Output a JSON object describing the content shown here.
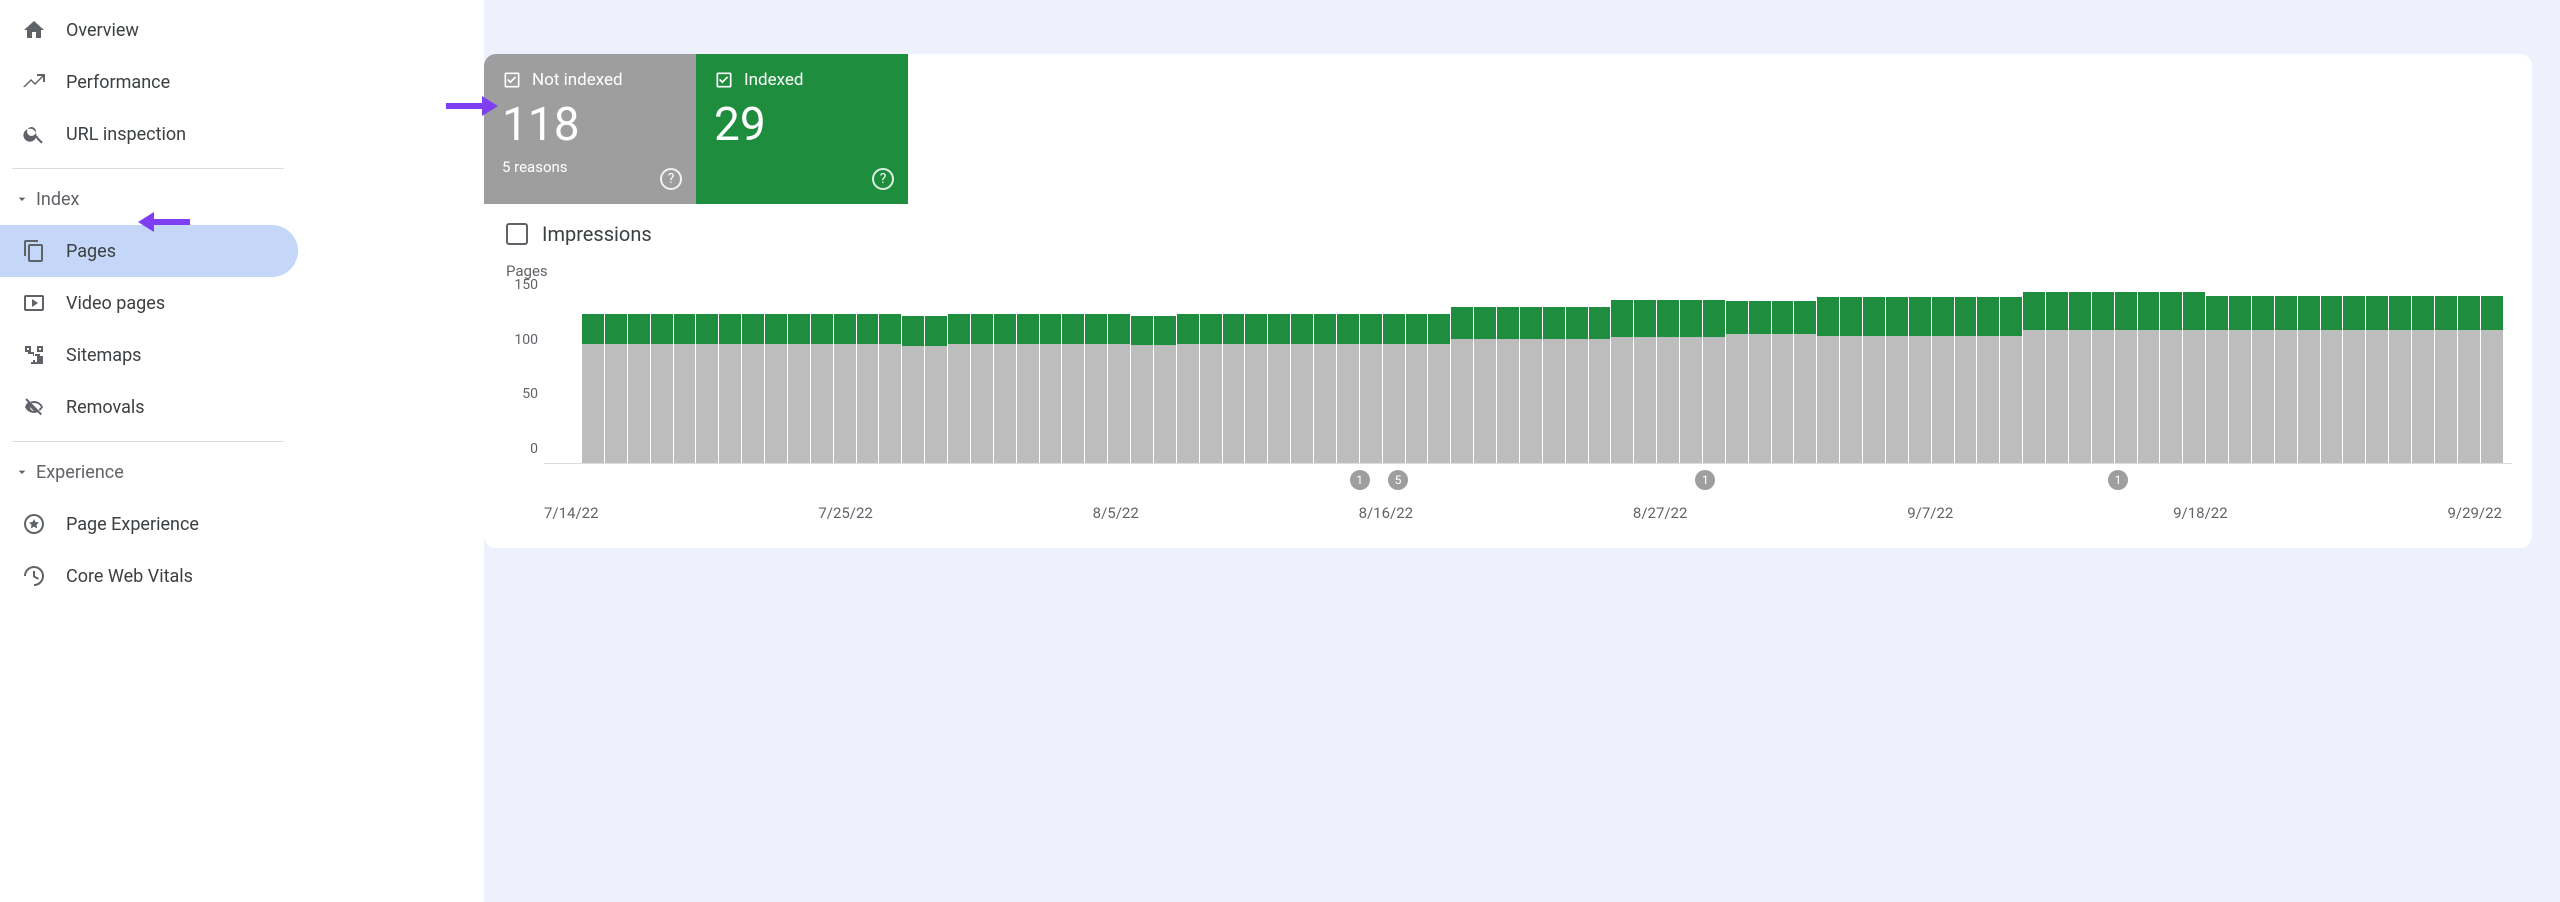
{
  "sidebar": {
    "top": [
      {
        "label": "Overview",
        "icon": "home"
      },
      {
        "label": "Performance",
        "icon": "trend"
      },
      {
        "label": "URL inspection",
        "icon": "search"
      }
    ],
    "sections": [
      {
        "title": "Index",
        "items": [
          {
            "label": "Pages",
            "icon": "pages",
            "active": true
          },
          {
            "label": "Video pages",
            "icon": "video"
          },
          {
            "label": "Sitemaps",
            "icon": "sitemap"
          },
          {
            "label": "Removals",
            "icon": "eye-off"
          }
        ]
      },
      {
        "title": "Experience",
        "items": [
          {
            "label": "Page Experience",
            "icon": "star-circle"
          },
          {
            "label": "Core Web Vitals",
            "icon": "speed"
          }
        ]
      }
    ]
  },
  "stats": {
    "not_indexed": {
      "label": "Not indexed",
      "value": "118",
      "sub": "5 reasons"
    },
    "indexed": {
      "label": "Indexed",
      "value": "29"
    }
  },
  "impressions_label": "Impressions",
  "chart_data": {
    "type": "bar",
    "ylabel": "Pages",
    "ylim": [
      0,
      150
    ],
    "yticks": [
      0,
      50,
      100,
      150
    ],
    "x_ticks": [
      "7/14/22",
      "7/25/22",
      "8/5/22",
      "8/16/22",
      "8/27/22",
      "9/7/22",
      "9/18/22",
      "9/29/22"
    ],
    "series": [
      {
        "name": "Not indexed",
        "color": "#bdbdbd"
      },
      {
        "name": "Indexed",
        "color": "#1e8e3e"
      }
    ],
    "bars": [
      {
        "ni": 100,
        "ix": 25
      },
      {
        "ni": 100,
        "ix": 25
      },
      {
        "ni": 100,
        "ix": 25
      },
      {
        "ni": 100,
        "ix": 25
      },
      {
        "ni": 100,
        "ix": 25
      },
      {
        "ni": 100,
        "ix": 25
      },
      {
        "ni": 100,
        "ix": 25
      },
      {
        "ni": 100,
        "ix": 25
      },
      {
        "ni": 100,
        "ix": 25
      },
      {
        "ni": 100,
        "ix": 25
      },
      {
        "ni": 100,
        "ix": 25
      },
      {
        "ni": 100,
        "ix": 25
      },
      {
        "ni": 100,
        "ix": 25
      },
      {
        "ni": 100,
        "ix": 25
      },
      {
        "ni": 98,
        "ix": 25
      },
      {
        "ni": 98,
        "ix": 25
      },
      {
        "ni": 100,
        "ix": 25
      },
      {
        "ni": 100,
        "ix": 25
      },
      {
        "ni": 100,
        "ix": 25
      },
      {
        "ni": 100,
        "ix": 25
      },
      {
        "ni": 100,
        "ix": 25
      },
      {
        "ni": 100,
        "ix": 25
      },
      {
        "ni": 100,
        "ix": 25
      },
      {
        "ni": 100,
        "ix": 25
      },
      {
        "ni": 99,
        "ix": 24
      },
      {
        "ni": 99,
        "ix": 24
      },
      {
        "ni": 100,
        "ix": 25
      },
      {
        "ni": 100,
        "ix": 25
      },
      {
        "ni": 100,
        "ix": 25
      },
      {
        "ni": 100,
        "ix": 25
      },
      {
        "ni": 100,
        "ix": 25
      },
      {
        "ni": 100,
        "ix": 25
      },
      {
        "ni": 100,
        "ix": 25
      },
      {
        "ni": 100,
        "ix": 25
      },
      {
        "ni": 100,
        "ix": 25
      },
      {
        "ni": 100,
        "ix": 25
      },
      {
        "ni": 100,
        "ix": 25
      },
      {
        "ni": 100,
        "ix": 25
      },
      {
        "ni": 104,
        "ix": 27
      },
      {
        "ni": 104,
        "ix": 27
      },
      {
        "ni": 104,
        "ix": 27
      },
      {
        "ni": 104,
        "ix": 27
      },
      {
        "ni": 104,
        "ix": 27
      },
      {
        "ni": 104,
        "ix": 27
      },
      {
        "ni": 104,
        "ix": 27
      },
      {
        "ni": 106,
        "ix": 31
      },
      {
        "ni": 106,
        "ix": 31
      },
      {
        "ni": 106,
        "ix": 31
      },
      {
        "ni": 106,
        "ix": 31
      },
      {
        "ni": 106,
        "ix": 31
      },
      {
        "ni": 108,
        "ix": 28
      },
      {
        "ni": 108,
        "ix": 28
      },
      {
        "ni": 108,
        "ix": 28
      },
      {
        "ni": 108,
        "ix": 28
      },
      {
        "ni": 107,
        "ix": 32
      },
      {
        "ni": 107,
        "ix": 32
      },
      {
        "ni": 107,
        "ix": 32
      },
      {
        "ni": 107,
        "ix": 32
      },
      {
        "ni": 107,
        "ix": 32
      },
      {
        "ni": 107,
        "ix": 32
      },
      {
        "ni": 107,
        "ix": 32
      },
      {
        "ni": 107,
        "ix": 32
      },
      {
        "ni": 107,
        "ix": 32
      },
      {
        "ni": 112,
        "ix": 31
      },
      {
        "ni": 112,
        "ix": 31
      },
      {
        "ni": 112,
        "ix": 31
      },
      {
        "ni": 112,
        "ix": 31
      },
      {
        "ni": 112,
        "ix": 31
      },
      {
        "ni": 112,
        "ix": 31
      },
      {
        "ni": 112,
        "ix": 31
      },
      {
        "ni": 112,
        "ix": 31
      },
      {
        "ni": 112,
        "ix": 28
      },
      {
        "ni": 112,
        "ix": 28
      },
      {
        "ni": 112,
        "ix": 28
      },
      {
        "ni": 112,
        "ix": 28
      },
      {
        "ni": 112,
        "ix": 28
      },
      {
        "ni": 112,
        "ix": 28
      },
      {
        "ni": 112,
        "ix": 28
      },
      {
        "ni": 112,
        "ix": 28
      },
      {
        "ni": 112,
        "ix": 28
      },
      {
        "ni": 112,
        "ix": 28
      },
      {
        "ni": 112,
        "ix": 28
      },
      {
        "ni": 112,
        "ix": 28
      },
      {
        "ni": 112,
        "ix": 28
      }
    ],
    "markers": [
      {
        "pos_pct": 40.5,
        "label": "1"
      },
      {
        "pos_pct": 42.5,
        "label": "5"
      },
      {
        "pos_pct": 58.5,
        "label": "1"
      },
      {
        "pos_pct": 80.0,
        "label": "1"
      }
    ]
  }
}
